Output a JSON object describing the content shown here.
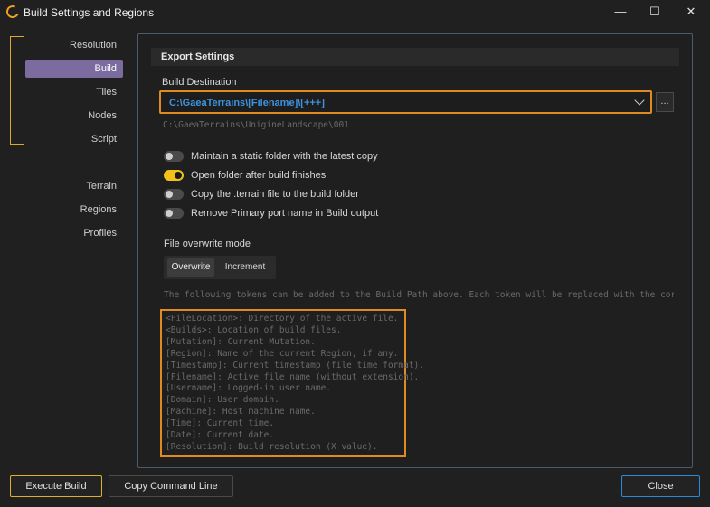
{
  "window": {
    "title": "Build Settings and Regions",
    "minimize": "—",
    "maximize": "☐",
    "close": "✕"
  },
  "sidebar": {
    "group1": [
      "Resolution",
      "Build",
      "Tiles",
      "Nodes",
      "Script"
    ],
    "group2": [
      "Terrain",
      "Regions",
      "Profiles"
    ],
    "active": "Build"
  },
  "export": {
    "header": "Export Settings",
    "destination_label": "Build Destination",
    "destination_value": "C:\\GaeaTerrains\\[Filename]\\[+++]",
    "browse_label": "...",
    "resolved_path": "C:\\GaeaTerrains\\UnigineLandscape\\001",
    "toggles": [
      {
        "label": "Maintain a static folder with the latest copy",
        "on": false
      },
      {
        "label": "Open folder after build finishes",
        "on": true
      },
      {
        "label": "Copy the .terrain file to the build folder",
        "on": false
      },
      {
        "label": "Remove Primary port name in Build output",
        "on": false
      }
    ],
    "overwrite_label": "File overwrite mode",
    "overwrite_options": [
      "Overwrite",
      "Increment"
    ],
    "hint": "The following tokens can be added to the Build Path above. Each token will be replaced with the corresponding",
    "tokens": [
      "<FileLocation>: Directory of the active file.",
      "<Builds>: Location of build files.",
      "[Mutation]: Current Mutation.",
      "[Region]: Name of the current Region, if any.",
      "[Timestamp]: Current timestamp (file time format).",
      "[Filename]: Active file name (without extension).",
      "[Username]: Logged-in user name.",
      "[Domain]: User domain.",
      "[Machine]: Host machine name.",
      "[Time]: Current time.",
      "[Date]: Current date.",
      "[Resolution]: Build resolution (X value)."
    ]
  },
  "footer": {
    "execute": "Execute Build",
    "copy": "Copy Command Line",
    "close": "Close"
  },
  "colors": {
    "accent_orange": "#e08a20",
    "active_nav": "#7b6b9e",
    "toggle_on": "#f2c21a",
    "path_blue": "#3d93e0",
    "close_border": "#2b8ad8"
  }
}
